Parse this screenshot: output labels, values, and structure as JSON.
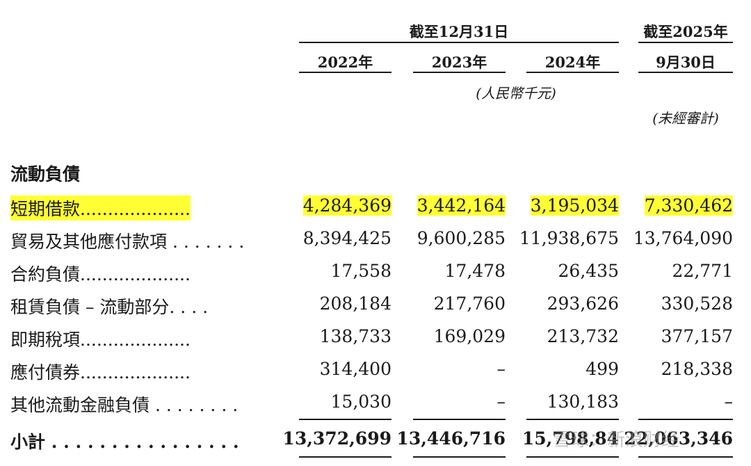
{
  "header": {
    "period_group": "截至12月31日",
    "col2022": "2022年",
    "col2023": "2023年",
    "col2024": "2024年",
    "col2025_line1": "截至2025年",
    "col2025_line2": "9月30日",
    "unit_note": "(人民幣千元)",
    "unaudited_note": "(未經審計)"
  },
  "section_title": "流動負債",
  "rows": [
    {
      "label": "短期借款",
      "dots": "....................",
      "v2022": "4,284,369",
      "v2023": "3,442,164",
      "v2024": "3,195,034",
      "v2025": "7,330,462",
      "highlight": "#ffff33"
    },
    {
      "label": "貿易及其他應付款項",
      "dots": ". . . . . . .",
      "v2022": "8,394,425",
      "v2023": "9,600,285",
      "v2024": "11,938,675",
      "v2025": "13,764,090"
    },
    {
      "label": "合約負債",
      "dots": "....................",
      "v2022": "17,558",
      "v2023": "17,478",
      "v2024": "26,435",
      "v2025": "22,771"
    },
    {
      "label": "租賃負債 – 流動部分",
      "dots": ". . . .",
      "v2022": "208,184",
      "v2023": "217,760",
      "v2024": "293,626",
      "v2025": "330,528"
    },
    {
      "label": "即期稅項",
      "dots": "....................",
      "v2022": "138,733",
      "v2023": "169,029",
      "v2024": "213,732",
      "v2025": "377,157"
    },
    {
      "label": "應付債券",
      "dots": "....................",
      "v2022": "314,400",
      "v2023": "–",
      "v2024": "499",
      "v2025": "218,338"
    },
    {
      "label": "其他流動金融負債",
      "dots": ". . . . . . . .",
      "v2022": "15,030",
      "v2023": "–",
      "v2024": "130,183",
      "v2025": "–"
    }
  ],
  "total": {
    "label": "小計",
    "dots": ". . . . . . . . . . . . . . . .",
    "v2022": "13,372,699",
    "v2023": "13,446,716",
    "v2024": "15,798,84",
    "v2025": "22,063,346"
  },
  "watermark": "雪球：新浪财经"
}
